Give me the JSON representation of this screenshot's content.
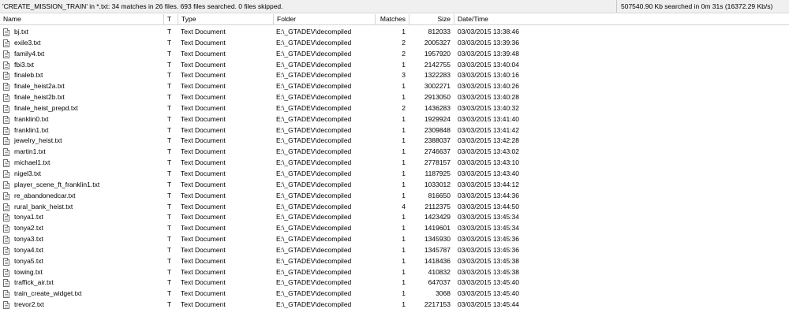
{
  "status": {
    "search_summary": "'CREATE_MISSION_TRAIN' in *.txt: 34 matches in 26 files. 693 files searched. 0 files skipped.",
    "size_summary": "507540.90 Kb searched in 0m 31s (16372.29 Kb/s)"
  },
  "columns": {
    "name": "Name",
    "t": "T",
    "type": "Type",
    "folder": "Folder",
    "matches": "Matches",
    "size": "Size",
    "datetime": "Date/Time"
  },
  "icons": {
    "file": "text-file-icon"
  },
  "rows": [
    {
      "name": "bj.txt",
      "t": "T",
      "type": "Text Document",
      "folder": "E:\\_GTADEV\\decompiled",
      "matches": "1",
      "size": "812033",
      "datetime": "03/03/2015 13:38:46"
    },
    {
      "name": "exile3.txt",
      "t": "T",
      "type": "Text Document",
      "folder": "E:\\_GTADEV\\decompiled",
      "matches": "2",
      "size": "2005327",
      "datetime": "03/03/2015 13:39:36"
    },
    {
      "name": "family4.txt",
      "t": "T",
      "type": "Text Document",
      "folder": "E:\\_GTADEV\\decompiled",
      "matches": "2",
      "size": "1957920",
      "datetime": "03/03/2015 13:39:48"
    },
    {
      "name": "fbi3.txt",
      "t": "T",
      "type": "Text Document",
      "folder": "E:\\_GTADEV\\decompiled",
      "matches": "1",
      "size": "2142755",
      "datetime": "03/03/2015 13:40:04"
    },
    {
      "name": "finaleb.txt",
      "t": "T",
      "type": "Text Document",
      "folder": "E:\\_GTADEV\\decompiled",
      "matches": "3",
      "size": "1322283",
      "datetime": "03/03/2015 13:40:16"
    },
    {
      "name": "finale_heist2a.txt",
      "t": "T",
      "type": "Text Document",
      "folder": "E:\\_GTADEV\\decompiled",
      "matches": "1",
      "size": "3002271",
      "datetime": "03/03/2015 13:40:26"
    },
    {
      "name": "finale_heist2b.txt",
      "t": "T",
      "type": "Text Document",
      "folder": "E:\\_GTADEV\\decompiled",
      "matches": "1",
      "size": "2913050",
      "datetime": "03/03/2015 13:40:28"
    },
    {
      "name": "finale_heist_prepd.txt",
      "t": "T",
      "type": "Text Document",
      "folder": "E:\\_GTADEV\\decompiled",
      "matches": "2",
      "size": "1436283",
      "datetime": "03/03/2015 13:40:32"
    },
    {
      "name": "franklin0.txt",
      "t": "T",
      "type": "Text Document",
      "folder": "E:\\_GTADEV\\decompiled",
      "matches": "1",
      "size": "1929924",
      "datetime": "03/03/2015 13:41:40"
    },
    {
      "name": "franklin1.txt",
      "t": "T",
      "type": "Text Document",
      "folder": "E:\\_GTADEV\\decompiled",
      "matches": "1",
      "size": "2309848",
      "datetime": "03/03/2015 13:41:42"
    },
    {
      "name": "jewelry_heist.txt",
      "t": "T",
      "type": "Text Document",
      "folder": "E:\\_GTADEV\\decompiled",
      "matches": "1",
      "size": "2388037",
      "datetime": "03/03/2015 13:42:28"
    },
    {
      "name": "martin1.txt",
      "t": "T",
      "type": "Text Document",
      "folder": "E:\\_GTADEV\\decompiled",
      "matches": "1",
      "size": "2746637",
      "datetime": "03/03/2015 13:43:02"
    },
    {
      "name": "michael1.txt",
      "t": "T",
      "type": "Text Document",
      "folder": "E:\\_GTADEV\\decompiled",
      "matches": "1",
      "size": "2778157",
      "datetime": "03/03/2015 13:43:10"
    },
    {
      "name": "nigel3.txt",
      "t": "T",
      "type": "Text Document",
      "folder": "E:\\_GTADEV\\decompiled",
      "matches": "1",
      "size": "1187925",
      "datetime": "03/03/2015 13:43:40"
    },
    {
      "name": "player_scene_ft_franklin1.txt",
      "t": "T",
      "type": "Text Document",
      "folder": "E:\\_GTADEV\\decompiled",
      "matches": "1",
      "size": "1033012",
      "datetime": "03/03/2015 13:44:12"
    },
    {
      "name": "re_abandonedcar.txt",
      "t": "T",
      "type": "Text Document",
      "folder": "E:\\_GTADEV\\decompiled",
      "matches": "1",
      "size": "816650",
      "datetime": "03/03/2015 13:44:36"
    },
    {
      "name": "rural_bank_heist.txt",
      "t": "T",
      "type": "Text Document",
      "folder": "E:\\_GTADEV\\decompiled",
      "matches": "4",
      "size": "2112375",
      "datetime": "03/03/2015 13:44:50"
    },
    {
      "name": "tonya1.txt",
      "t": "T",
      "type": "Text Document",
      "folder": "E:\\_GTADEV\\decompiled",
      "matches": "1",
      "size": "1423429",
      "datetime": "03/03/2015 13:45:34"
    },
    {
      "name": "tonya2.txt",
      "t": "T",
      "type": "Text Document",
      "folder": "E:\\_GTADEV\\decompiled",
      "matches": "1",
      "size": "1419601",
      "datetime": "03/03/2015 13:45:34"
    },
    {
      "name": "tonya3.txt",
      "t": "T",
      "type": "Text Document",
      "folder": "E:\\_GTADEV\\decompiled",
      "matches": "1",
      "size": "1345930",
      "datetime": "03/03/2015 13:45:36"
    },
    {
      "name": "tonya4.txt",
      "t": "T",
      "type": "Text Document",
      "folder": "E:\\_GTADEV\\decompiled",
      "matches": "1",
      "size": "1345787",
      "datetime": "03/03/2015 13:45:36"
    },
    {
      "name": "tonya5.txt",
      "t": "T",
      "type": "Text Document",
      "folder": "E:\\_GTADEV\\decompiled",
      "matches": "1",
      "size": "1418436",
      "datetime": "03/03/2015 13:45:38"
    },
    {
      "name": "towing.txt",
      "t": "T",
      "type": "Text Document",
      "folder": "E:\\_GTADEV\\decompiled",
      "matches": "1",
      "size": "410832",
      "datetime": "03/03/2015 13:45:38"
    },
    {
      "name": "traffick_air.txt",
      "t": "T",
      "type": "Text Document",
      "folder": "E:\\_GTADEV\\decompiled",
      "matches": "1",
      "size": "647037",
      "datetime": "03/03/2015 13:45:40"
    },
    {
      "name": "train_create_widget.txt",
      "t": "T",
      "type": "Text Document",
      "folder": "E:\\_GTADEV\\decompiled",
      "matches": "1",
      "size": "3068",
      "datetime": "03/03/2015 13:45:40"
    },
    {
      "name": "trevor2.txt",
      "t": "T",
      "type": "Text Document",
      "folder": "E:\\_GTADEV\\decompiled",
      "matches": "1",
      "size": "2217153",
      "datetime": "03/03/2015 13:45:44"
    }
  ]
}
